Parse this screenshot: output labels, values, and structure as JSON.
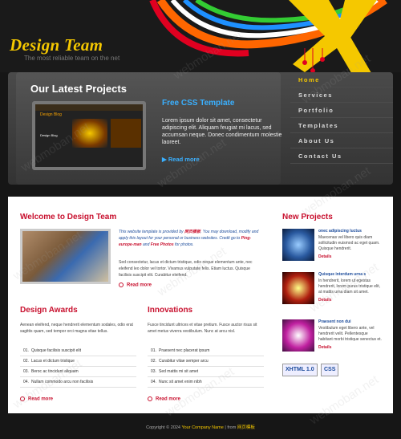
{
  "header": {
    "logo": "Design Team",
    "tagline": "The most reliable team on the net"
  },
  "feature": {
    "title": "Our Latest Projects",
    "screenshot": {
      "site_title": "Design Blog",
      "blog_label": "Design Blog"
    },
    "content_title": "Free CSS Template",
    "content_text": "Lorem ipsum dolor sit amet, consectetur adipiscing elit. Aliquam feugiat mi lacus, sed accumsan neque. Donec condimentum molestie laoreet.",
    "read_more": "Read more"
  },
  "nav": {
    "items": [
      "Home",
      "Services",
      "Portfolio",
      "Templates",
      "About Us",
      "Contact Us"
    ]
  },
  "welcome": {
    "title": "Welcome to Design Team",
    "intro_a": "This website template is provided by",
    "intro_brand": "网页模板",
    "intro_b": ". You may download, modify and apply this layout for your personal or business websites. Credit go to",
    "intro_credit": "Ping-europe-man",
    "intro_c": "and",
    "intro_free": "Free Photos",
    "intro_d": "for photos.",
    "text": "Sed consectetur, lacus et dictum tristique, odio neque elementum ante, nec eleifend leo dolor vel tortor. Vivamus vulputate felis. Etiam luctus. Quisque facilisis suscipit elit. Curabitur eleifend.",
    "read_more": "Read more"
  },
  "awards": {
    "title": "Design Awards",
    "text": "Aenean eleifend, neque hendrerit elementum sodales, odio erat sagittis quam, sed tempor orci magna vitae tellus.",
    "items": [
      "Quisque facilisis suscipit elit",
      "Lacus et dictum tristique",
      "Beroc ac tincidunt aliquam",
      "Nullam commodo arcu non facilisis"
    ],
    "read_more": "Read more"
  },
  "innovations": {
    "title": "Innovations",
    "text": "Fusce tincidunt ultrices et vitae pretium. Fusce auctor risus sit amet metus viverra vestibulum. Nunc at arcu nisl.",
    "items": [
      "Praesent nec placerat ipsum",
      "Curabitur vitae semper arcu",
      "Sed mattis mi sit amet",
      "Nunc sit amet enim nibh"
    ],
    "read_more": "Read more"
  },
  "new_projects": {
    "title": "New Projects",
    "items": [
      {
        "title": "onec adipiscing luctus",
        "desc": "Maecenas vel libero quis diam sollicitudin euismod ac eget quam. Quisque hendrerit.",
        "link": "Details",
        "color": "#2a5aa0"
      },
      {
        "title": "Quisque interdum urna s",
        "desc": "In hendrerit, lorem ut egestas hendrerit, lorem purus tristique elit, at mattis urna diam sit amet.",
        "link": "Details",
        "color": "#b02010"
      },
      {
        "title": "Praesent non dui",
        "desc": "Vestibulum eget libero ante, vel hendrerit velit. Pellentesque habitant morbi tristique senectus et.",
        "link": "Details",
        "color": "#c020a0"
      }
    ],
    "badge_xhtml": "XHTML 1.0",
    "badge_css": "CSS"
  },
  "footer": {
    "copyright": "Copyright © 2024",
    "company": "Your Company Name",
    "sep": "| from",
    "source": "网页模板"
  },
  "watermark": "webmoban.net",
  "colors": {
    "accent": "#c8102e",
    "yellow": "#f5c800",
    "blue": "#3ab0ff"
  }
}
